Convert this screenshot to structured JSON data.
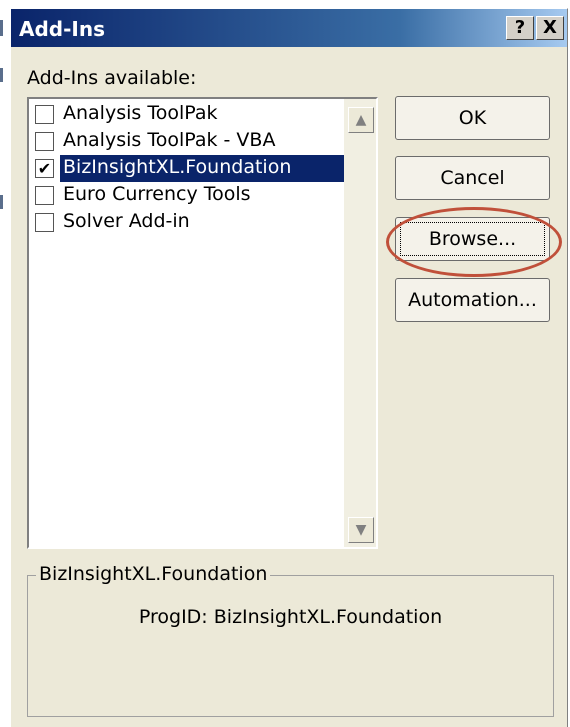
{
  "window": {
    "title": "Add-Ins",
    "help_label": "?",
    "close_label": "X"
  },
  "addins": {
    "label": "Add-Ins available:",
    "items": [
      {
        "label": "Analysis ToolPak",
        "checked": false,
        "check_glyph": ""
      },
      {
        "label": "Analysis ToolPak - VBA",
        "checked": false,
        "check_glyph": ""
      },
      {
        "label": "BizInsightXL.Foundation",
        "checked": true,
        "selected": true,
        "check_glyph": "✔"
      },
      {
        "label": "Euro Currency Tools",
        "checked": false,
        "check_glyph": ""
      },
      {
        "label": "Solver Add-in",
        "checked": false,
        "check_glyph": ""
      }
    ],
    "scroll_up_glyph": "▲",
    "scroll_down_glyph": "▼"
  },
  "buttons": {
    "ok": "OK",
    "cancel": "Cancel",
    "browse": "Browse...",
    "automation": "Automation..."
  },
  "details": {
    "group_title": "BizInsightXL.Foundation",
    "description": "ProgID: BizInsightXL.Foundation"
  },
  "colors": {
    "titlebar_start": "#0a246a",
    "selection": "#0a246a",
    "dialog_bg": "#ece9d8",
    "annotation_ellipse": "#c0503a"
  }
}
